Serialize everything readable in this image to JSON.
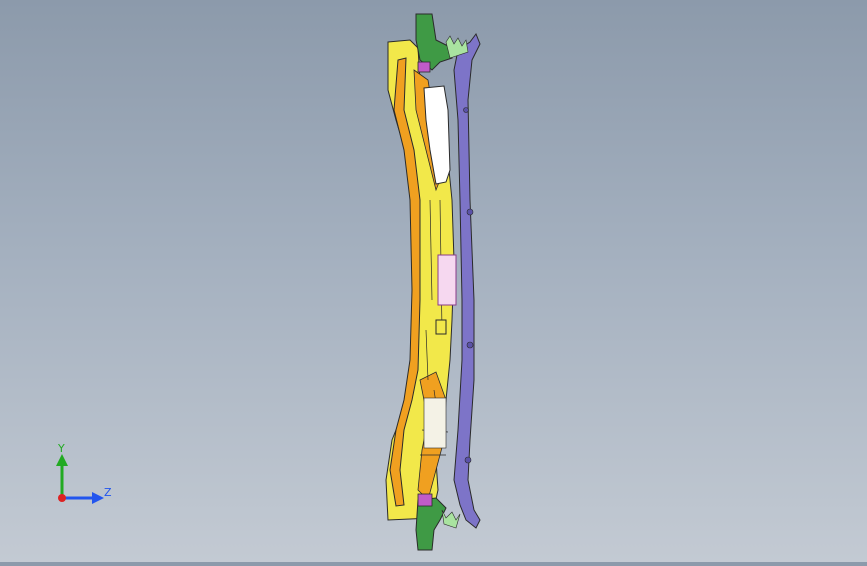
{
  "viewport": {
    "background_top": "#8c9aab",
    "background_bottom": "#c3cad3"
  },
  "model": {
    "colors": {
      "yellow_part": "#f2e84a",
      "orange_part": "#f0a020",
      "purple_bar": "#7d74c8",
      "green_part": "#3f9a45",
      "magenta_bracket": "#c05bc8",
      "outline": "#2a2a2a"
    }
  },
  "triad": {
    "y_label": "Y",
    "z_label": "Z",
    "y_color": "#22aa22",
    "z_color": "#2255ee",
    "x_color": "#dd2222"
  }
}
